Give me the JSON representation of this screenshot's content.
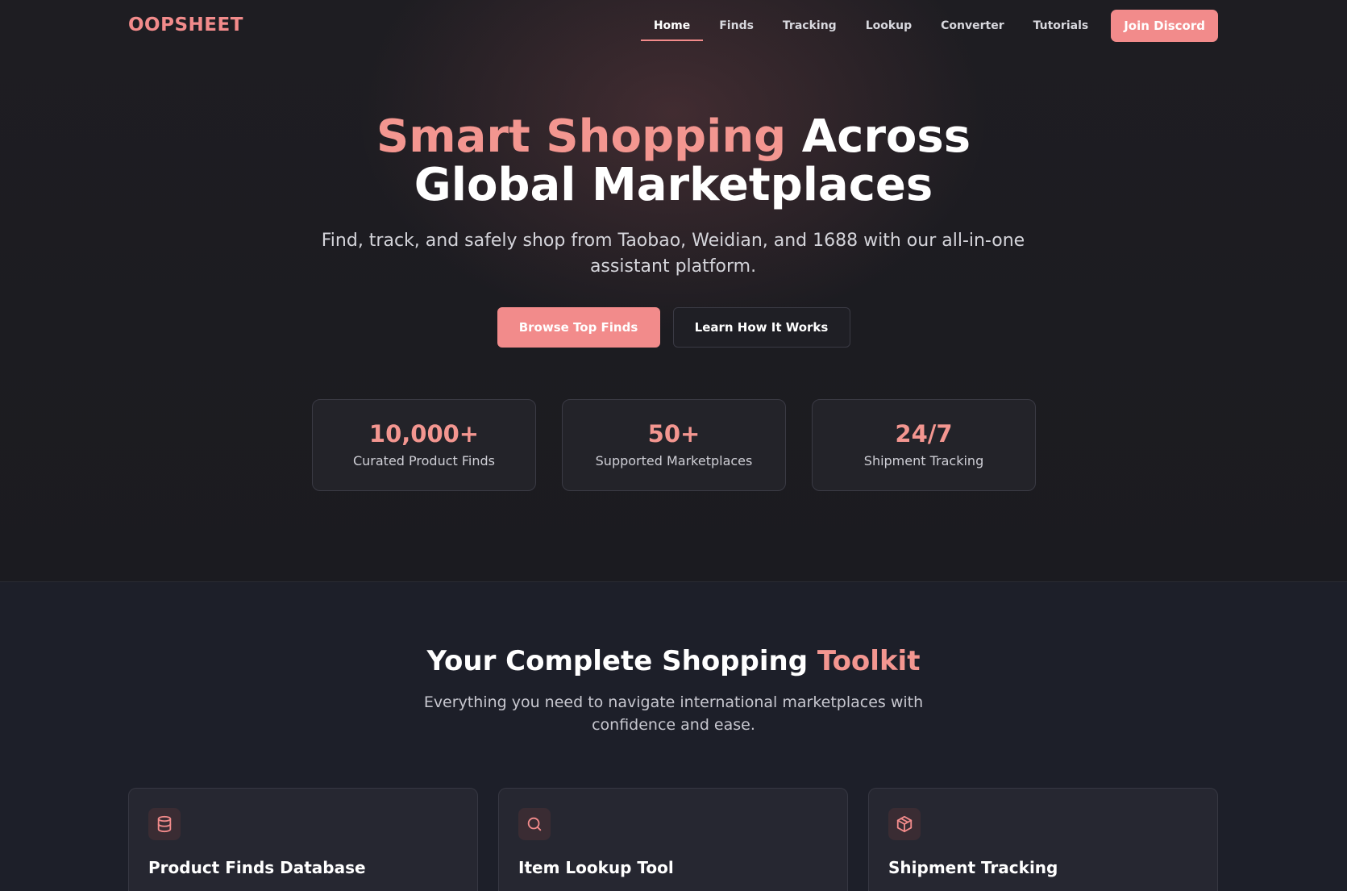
{
  "brand": {
    "logo": "OOPSHEET",
    "accent_color": "#f28b8b"
  },
  "nav": {
    "items": [
      {
        "label": "Home",
        "active": true
      },
      {
        "label": "Finds"
      },
      {
        "label": "Tracking"
      },
      {
        "label": "Lookup"
      },
      {
        "label": "Converter"
      },
      {
        "label": "Tutorials"
      }
    ],
    "cta": "Join Discord"
  },
  "hero": {
    "headline_accent": "Smart Shopping",
    "headline_rest_line1": "Across",
    "headline_line2": "Global Marketplaces",
    "subtitle": "Find, track, and safely shop from Taobao, Weidian, and 1688 with our all-in-one assistant platform.",
    "primary_cta": "Browse Top Finds",
    "secondary_cta": "Learn How It Works",
    "stats": [
      {
        "value": "10,000+",
        "label": "Curated Product Finds"
      },
      {
        "value": "50+",
        "label": "Supported Marketplaces"
      },
      {
        "value": "24/7",
        "label": "Shipment Tracking"
      }
    ]
  },
  "toolkit": {
    "title_main": "Your Complete Shopping",
    "title_accent": "Toolkit",
    "subtitle": "Everything you need to navigate international marketplaces with confidence and ease.",
    "features": [
      {
        "icon": "database-icon",
        "title": "Product Finds Database"
      },
      {
        "icon": "search-icon",
        "title": "Item Lookup Tool"
      },
      {
        "icon": "package-icon",
        "title": "Shipment Tracking"
      }
    ]
  }
}
